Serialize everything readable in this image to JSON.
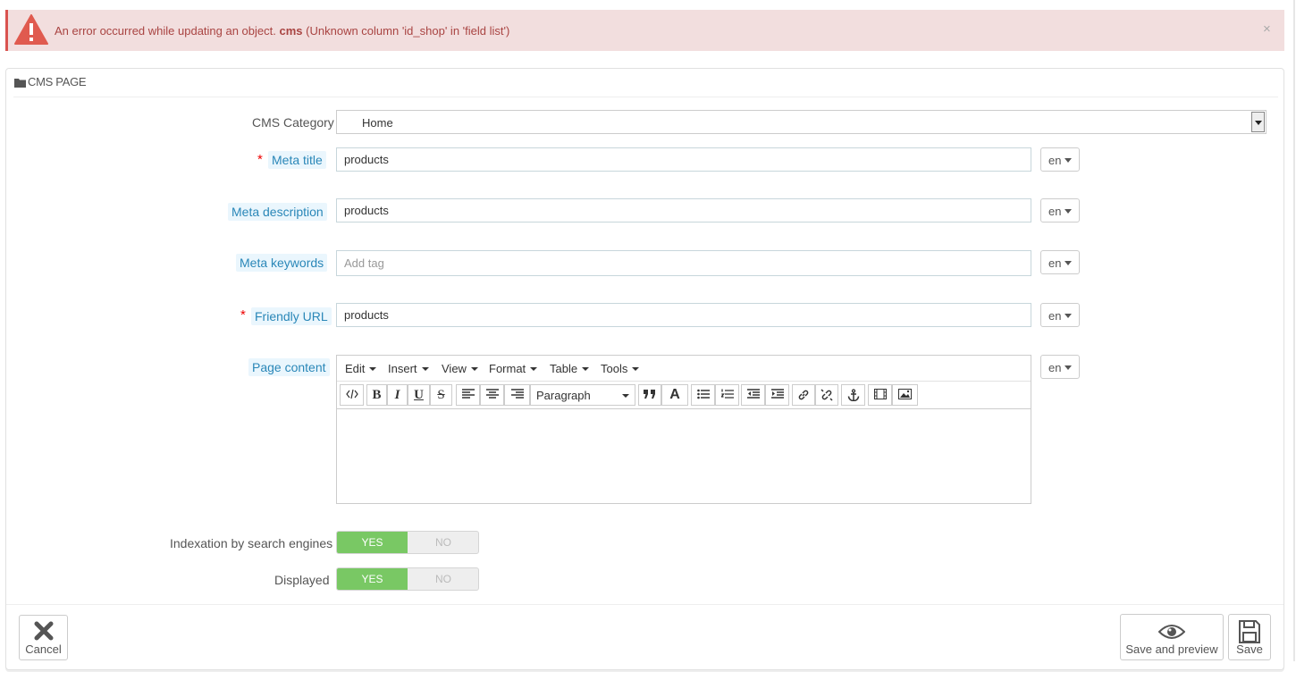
{
  "alert": {
    "message_prefix": "An error occurred while updating an object.",
    "message_bold": "cms",
    "message_suffix": "(Unknown column 'id_shop' in 'field list')",
    "close_glyph": "×",
    "icon": "warning-triangle-icon",
    "color": "#a94442"
  },
  "panel": {
    "title": "CMS PAGE",
    "icon": "folder-icon"
  },
  "form": {
    "category": {
      "label": "CMS Category",
      "value": "Home"
    },
    "meta_title": {
      "label": "Meta title",
      "value": "products",
      "lang": "en",
      "required": true
    },
    "meta_description": {
      "label": "Meta description",
      "value": "products",
      "lang": "en"
    },
    "meta_keywords": {
      "label": "Meta keywords",
      "placeholder": "Add tag",
      "lang": "en"
    },
    "friendly_url": {
      "label": "Friendly URL",
      "value": "products",
      "lang": "en",
      "required": true
    },
    "page_content": {
      "label": "Page content",
      "lang": "en",
      "menus": [
        "Edit",
        "Insert",
        "View",
        "Format",
        "Table",
        "Tools"
      ],
      "block_format": "Paragraph",
      "toolbar_icons": [
        "code-icon",
        "bold-icon",
        "italic-icon",
        "underline-icon",
        "strikethrough-icon",
        "align-left-icon",
        "align-center-icon",
        "align-right-icon",
        "blockquote-icon",
        "text-color-icon",
        "bullet-list-icon",
        "numbered-list-icon",
        "outdent-icon",
        "indent-icon",
        "link-icon",
        "unlink-icon",
        "anchor-icon",
        "media-icon",
        "image-icon"
      ]
    },
    "indexation": {
      "label": "Indexation by search engines",
      "yes": "YES",
      "no": "NO",
      "value": "YES"
    },
    "displayed": {
      "label": "Displayed",
      "yes": "YES",
      "no": "NO",
      "value": "YES"
    }
  },
  "required_marker": "*",
  "footer": {
    "cancel": "Cancel",
    "save_preview": "Save and preview",
    "save": "Save"
  },
  "colors": {
    "switch_on": "#79c864",
    "hint_label": "#2a87b8",
    "alert_bg": "#f2dede"
  }
}
